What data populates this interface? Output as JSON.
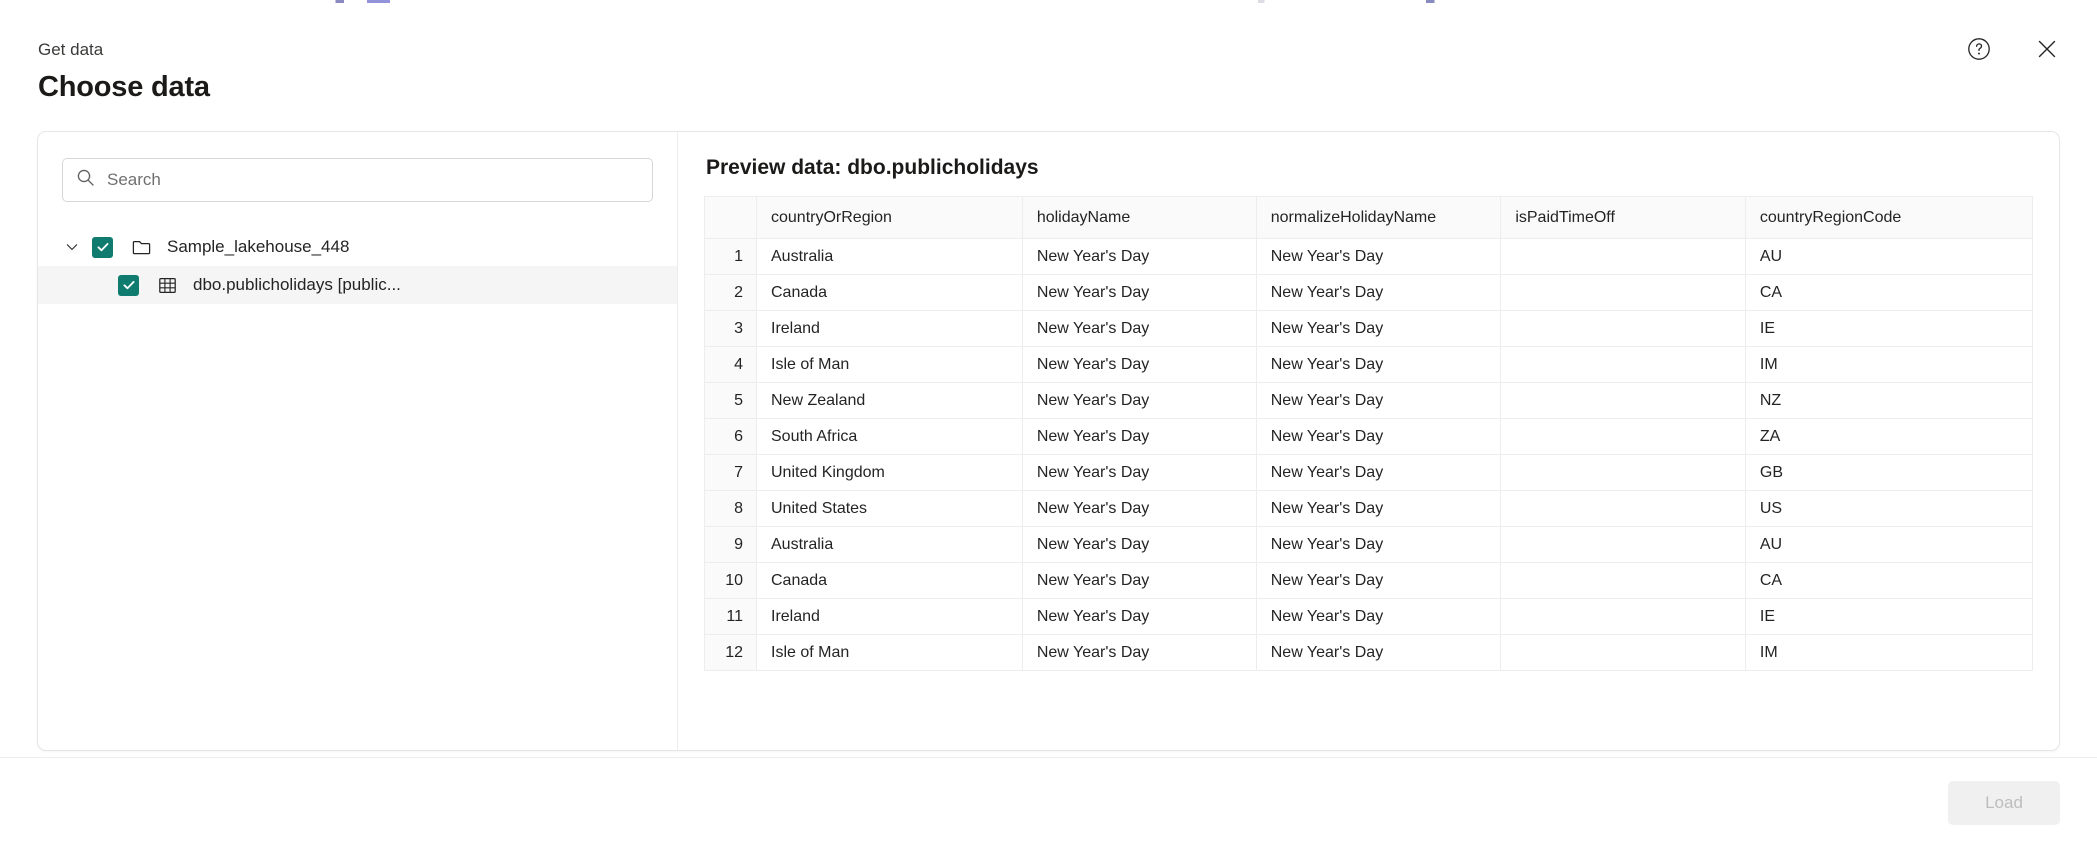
{
  "dialog": {
    "eyebrow": "Get data",
    "title": "Choose data",
    "help_icon": "help-circle-icon",
    "close_icon": "close-icon"
  },
  "search": {
    "placeholder": "Search",
    "value": "",
    "icon": "search-icon"
  },
  "tree": {
    "items": [
      {
        "label": "Sample_lakehouse_448",
        "icon": "folder-icon",
        "chevron": "chevron-down-icon",
        "checked": true,
        "selected": false,
        "level": 0
      },
      {
        "label": "dbo.publicholidays [public...",
        "icon": "table-icon",
        "checked": true,
        "selected": true,
        "level": 1
      }
    ]
  },
  "preview": {
    "title": "Preview data: dbo.publicholidays",
    "columns": [
      "countryOrRegion",
      "holidayName",
      "normalizeHolidayName",
      "isPaidTimeOff",
      "countryRegionCode"
    ],
    "rows": [
      {
        "n": "1",
        "cells": [
          "Australia",
          "New Year's Day",
          "New Year's Day",
          "",
          "AU"
        ]
      },
      {
        "n": "2",
        "cells": [
          "Canada",
          "New Year's Day",
          "New Year's Day",
          "",
          "CA"
        ]
      },
      {
        "n": "3",
        "cells": [
          "Ireland",
          "New Year's Day",
          "New Year's Day",
          "",
          "IE"
        ]
      },
      {
        "n": "4",
        "cells": [
          "Isle of Man",
          "New Year's Day",
          "New Year's Day",
          "",
          "IM"
        ]
      },
      {
        "n": "5",
        "cells": [
          "New Zealand",
          "New Year's Day",
          "New Year's Day",
          "",
          "NZ"
        ]
      },
      {
        "n": "6",
        "cells": [
          "South Africa",
          "New Year's Day",
          "New Year's Day",
          "",
          "ZA"
        ]
      },
      {
        "n": "7",
        "cells": [
          "United Kingdom",
          "New Year's Day",
          "New Year's Day",
          "",
          "GB"
        ]
      },
      {
        "n": "8",
        "cells": [
          "United States",
          "New Year's Day",
          "New Year's Day",
          "",
          "US"
        ]
      },
      {
        "n": "9",
        "cells": [
          "Australia",
          "New Year's Day",
          "New Year's Day",
          "",
          "AU"
        ]
      },
      {
        "n": "10",
        "cells": [
          "Canada",
          "New Year's Day",
          "New Year's Day",
          "",
          "CA"
        ]
      },
      {
        "n": "11",
        "cells": [
          "Ireland",
          "New Year's Day",
          "New Year's Day",
          "",
          "IE"
        ]
      },
      {
        "n": "12",
        "cells": [
          "Isle of Man",
          "New Year's Day",
          "New Year's Day",
          "",
          "IM"
        ]
      }
    ]
  },
  "footer": {
    "load_label": "Load",
    "load_disabled": true
  },
  "colors": {
    "checkbox_green": "#107c70",
    "selected_row": "#f5f5f5",
    "border": "#e6e6e6"
  }
}
